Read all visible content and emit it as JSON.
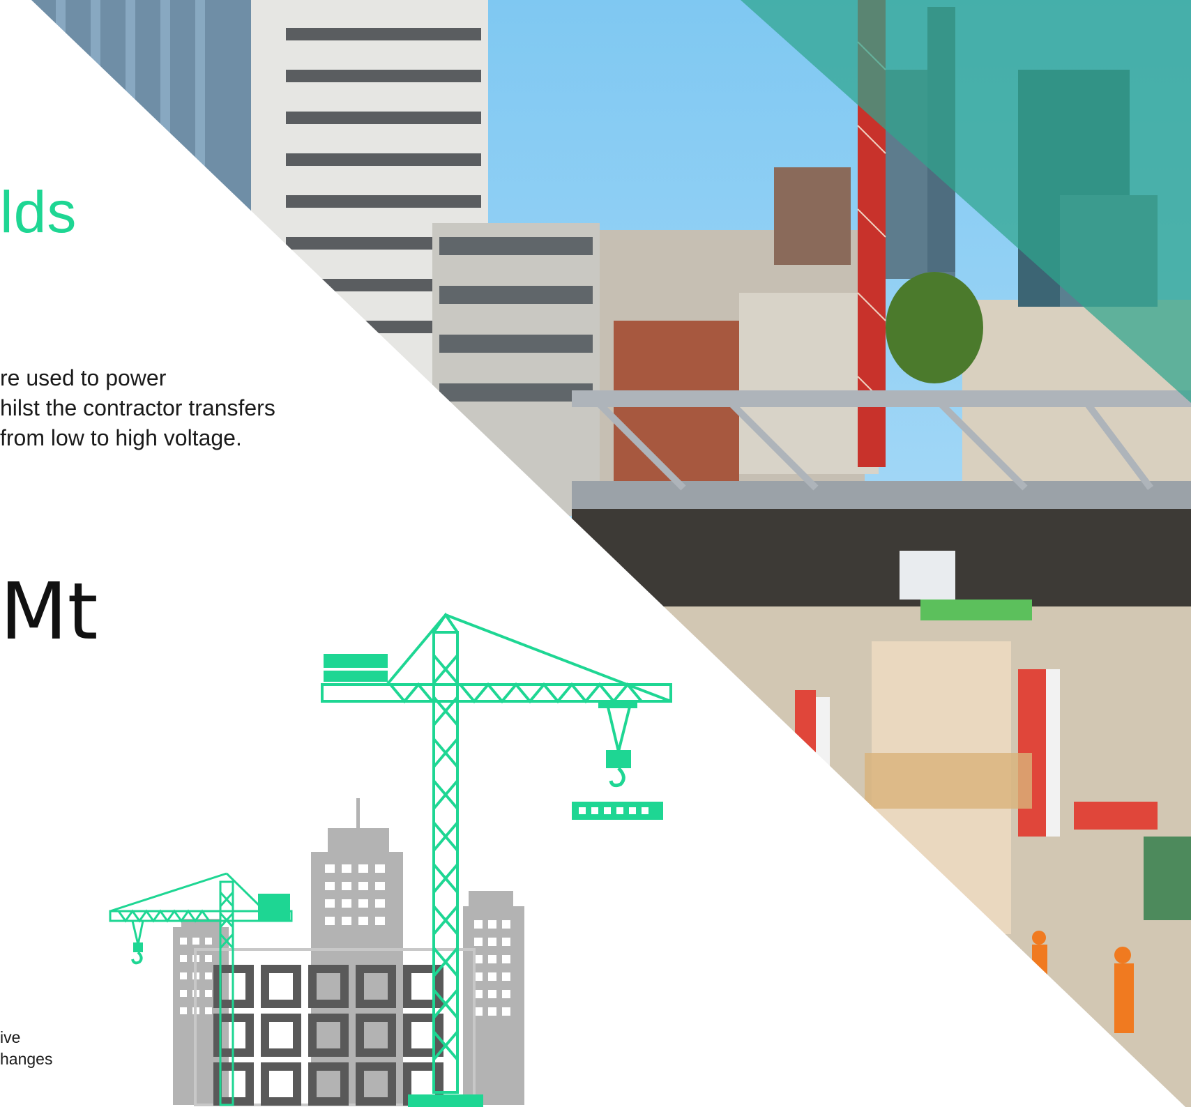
{
  "heading_fragment": "lds",
  "paragraph_lines": [
    "re used to power",
    "hilst the contractor transfers",
    "from low to high voltage."
  ],
  "big_value_fragment": "Mt",
  "caption_lines": [
    "ive",
    "hanges"
  ],
  "colors": {
    "accent_green": "#1ed693",
    "teal_overlay": "#2fa58e",
    "grey_building": "#b3b3b3",
    "dark_grey": "#555555"
  },
  "illustration": {
    "photo": "construction-site-photo",
    "crane_icon": "crane-icon",
    "buildings_icon": "buildings-icon"
  }
}
